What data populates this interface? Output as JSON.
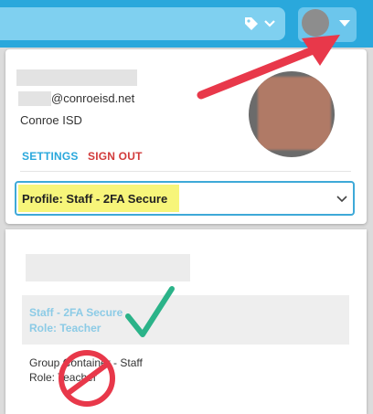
{
  "topbar": {
    "tag_icon": "tag-icon",
    "tag_caret_icon": "chevron-down-icon",
    "avatar_caret_icon": "caret-down-icon",
    "bar_color": "#2aa8dc"
  },
  "account": {
    "email_suffix": "@conroeisd.net",
    "organization": "Conroe ISD",
    "settings_label": "SETTINGS",
    "signout_label": "SIGN OUT",
    "settings_color": "#2aa8dc",
    "signout_color": "#d23b3b"
  },
  "profile_select": {
    "value": "Profile: Staff - 2FA Secure",
    "highlight_color": "#f7f57a"
  },
  "profile_options": [
    {
      "line1": "Staff - 2FA Secure",
      "line2": "Role: Teacher",
      "selected": true
    },
    {
      "line1": "Group Container - Staff",
      "line2": "Role: Teacher",
      "selected": false
    }
  ],
  "annotations": {
    "arrow_color": "#e8384a",
    "checkmark_color": "#2bb389",
    "no_symbol_color": "#e8384a"
  }
}
